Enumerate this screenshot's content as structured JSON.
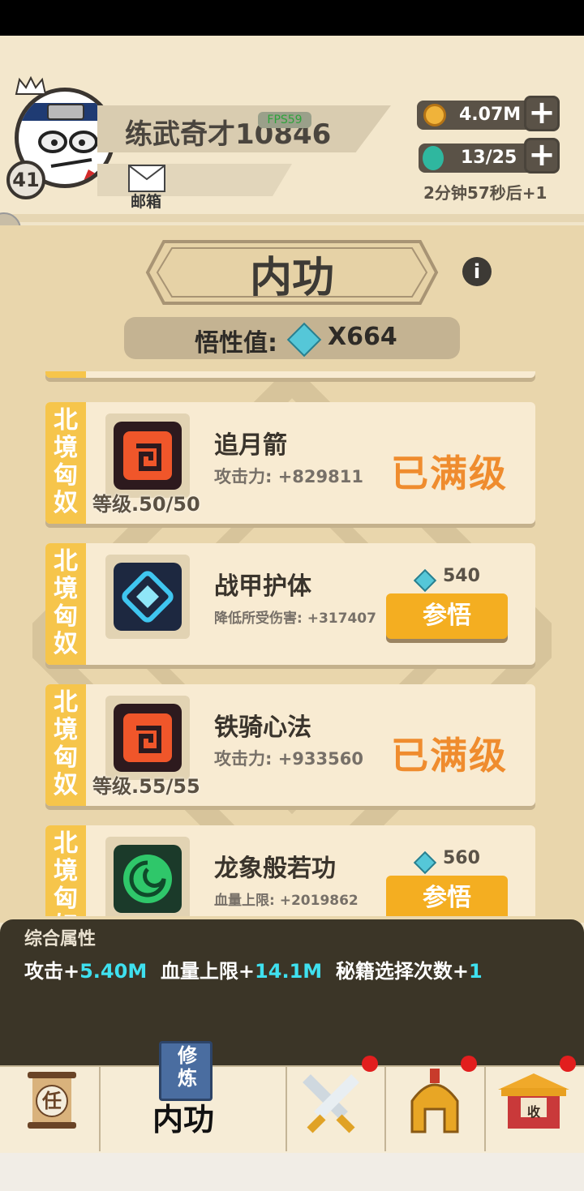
{
  "player": {
    "name": "练武奇才10846",
    "level": "41",
    "fps_badge": "FPS59",
    "mail_label": "邮箱"
  },
  "resources": {
    "coins": "4.07M",
    "energy": "13/25",
    "timer": "2分钟57秒后+1"
  },
  "panel": {
    "title": "内功",
    "info_icon": "i",
    "wuxing_label": "悟性值:",
    "wuxing_value": "X664"
  },
  "skills": [
    {
      "tag": "北境匈奴",
      "name": "追月箭",
      "stat": "攻击力: +829811",
      "level": "等级.50/50",
      "status": "已满级",
      "icon": "red-spiral-icon"
    },
    {
      "tag": "北境匈奴",
      "name": "战甲护体",
      "stat": "降低所受伤害: +317407",
      "cost": "540",
      "button": "参悟",
      "icon": "blue-gem-icon"
    },
    {
      "tag": "北境匈奴",
      "name": "铁骑心法",
      "stat": "攻击力: +933560",
      "level": "等级.55/55",
      "status": "已满级",
      "icon": "red-spiral-icon"
    },
    {
      "tag": "北境匈奴",
      "name": "龙象般若功",
      "stat": "血量上限: +2019862",
      "cost": "560",
      "button": "参悟",
      "icon": "green-swirl-icon"
    }
  ],
  "summary": {
    "title": "综合属性",
    "attack_label": "攻击+",
    "attack_value": "5.40M",
    "hp_label": "血量上限+",
    "hp_value": "14.1M",
    "secret_label": "秘籍选择次数+",
    "secret_value": "1"
  },
  "nav": {
    "task_char": "任",
    "book_text": "修炼",
    "active_label": "内功",
    "shop_char": "收"
  },
  "colors": {
    "accent_orange": "#ef8c2e",
    "button_yellow": "#f4ae21",
    "tag_yellow": "#f6c54b",
    "stat_cyan": "#3fe0ef"
  }
}
